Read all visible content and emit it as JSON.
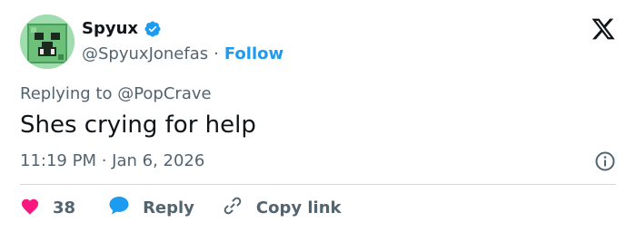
{
  "author": {
    "display_name": "Spyux",
    "handle": "@SpyuxJonefas",
    "separator": "·",
    "follow_label": "Follow"
  },
  "reply": {
    "prefix": "Replying to ",
    "mention": "@PopCrave"
  },
  "tweet": {
    "text": "Shes crying for help",
    "timestamp": "11:19 PM · Jan 6, 2026"
  },
  "actions": {
    "likes_count": "38",
    "reply_label": "Reply",
    "copy_label": "Copy link"
  },
  "colors": {
    "accent": "#1d9bf0",
    "like": "#f91880",
    "text": "#0f1419",
    "muted": "#536471"
  },
  "icons": {
    "avatar": "creeper-avatar",
    "verified": "verified-badge-icon",
    "logo": "x-logo-icon",
    "info": "info-icon",
    "like": "heart-icon",
    "reply": "speech-bubble-icon",
    "copy": "link-icon"
  }
}
